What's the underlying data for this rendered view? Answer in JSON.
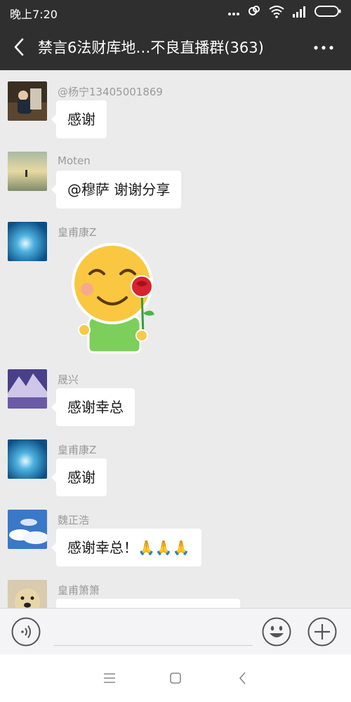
{
  "status_bar": {
    "time": "晚上7:20",
    "icons": [
      "more-dots-icon",
      "link-icon",
      "wifi-icon",
      "signal-icon",
      "battery-icon"
    ]
  },
  "header": {
    "title": "禁言6法财库地…不良直播群(363)",
    "back_icon": "chevron-left-icon",
    "more_icon": "more-icon"
  },
  "messages": [
    {
      "sender": "@杨宁13405001869",
      "text": "感谢",
      "avatar": "photo-portrait"
    },
    {
      "sender": "Moten",
      "text": "@穆萨 谢谢分享",
      "avatar": "photo-beach"
    },
    {
      "sender": "皇甫康Z",
      "sticker": "smiley-with-rose-sticker",
      "avatar": "photo-blue-water"
    },
    {
      "sender": "晟兴",
      "text": "感谢幸总",
      "avatar": "photo-mountain"
    },
    {
      "sender": "皇甫康Z",
      "text": "感谢",
      "avatar": "photo-blue-water"
    },
    {
      "sender": "魏正浩",
      "text": "感谢幸总！🙏🙏🙏",
      "avatar": "photo-sky"
    },
    {
      "sender": "皇甫箫箫",
      "text": "",
      "avatar": "photo-dog"
    }
  ],
  "input_bar": {
    "voice_icon": "voice-icon",
    "emoji_icon": "emoji-icon",
    "plus_icon": "plus-icon"
  },
  "nav_bar": {
    "icons": [
      "menu-icon",
      "home-square-icon",
      "back-triangle-icon"
    ]
  },
  "colors": {
    "header_bg": "#2f2f2f",
    "chat_bg": "#ebebeb",
    "bubble_bg": "#ffffff",
    "sender_text": "#9a9a9a"
  }
}
